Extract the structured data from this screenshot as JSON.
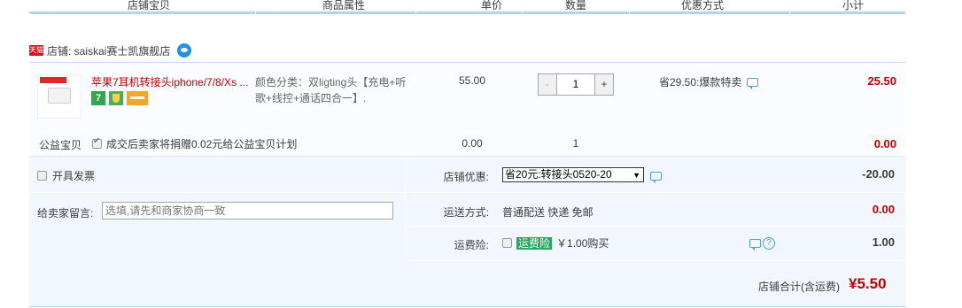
{
  "columns": [
    "店铺宝贝",
    "商品属性",
    "单价",
    "数量",
    "优惠方式",
    "小计"
  ],
  "shop": {
    "badge": "天猫",
    "name": "店铺: saiskai赛士凯旗舰店",
    "ww_icon": "wangwang-icon"
  },
  "item": {
    "title": "苹果7耳机转接头iphone/7/8/Xs ...",
    "badge_7": "7",
    "attr": "颜色分类：双ligting头【充电+听歌+线控+通话四合一】.",
    "price": "55.00",
    "qty": "1",
    "qty_minus": "-",
    "qty_plus": "+",
    "promo": "省29.50:爆款特卖",
    "subtotal": "25.50"
  },
  "charity": {
    "label": "公益宝贝",
    "checkbox_text": "成交后卖家将捐赠0.02元给公益宝贝计划",
    "price": "0.00",
    "qty": "1",
    "subtotal": "0.00"
  },
  "invoice": {
    "label": "开具发票"
  },
  "note": {
    "label": "给卖家留言:",
    "placeholder": "选填,请先和商家协商一致"
  },
  "discount": {
    "label": "店铺优惠:",
    "selected": "省20元:转接头0520-20",
    "amount": "-20.00"
  },
  "shipping": {
    "label": "运送方式:",
    "value": "普通配送 快递 免邮",
    "amount": "0.00"
  },
  "insurance": {
    "label": "运费险:",
    "tag": "运费险",
    "text": "￥1.00购买",
    "amount": "1.00"
  },
  "total": {
    "label": "店铺合计(含运费)",
    "value": "¥5.50"
  },
  "colors": {
    "accent_red": "#c40000",
    "border_blue": "#b2d1ff",
    "bg_blue": "#f2f7ff",
    "insurance_green": "#21a95b"
  }
}
